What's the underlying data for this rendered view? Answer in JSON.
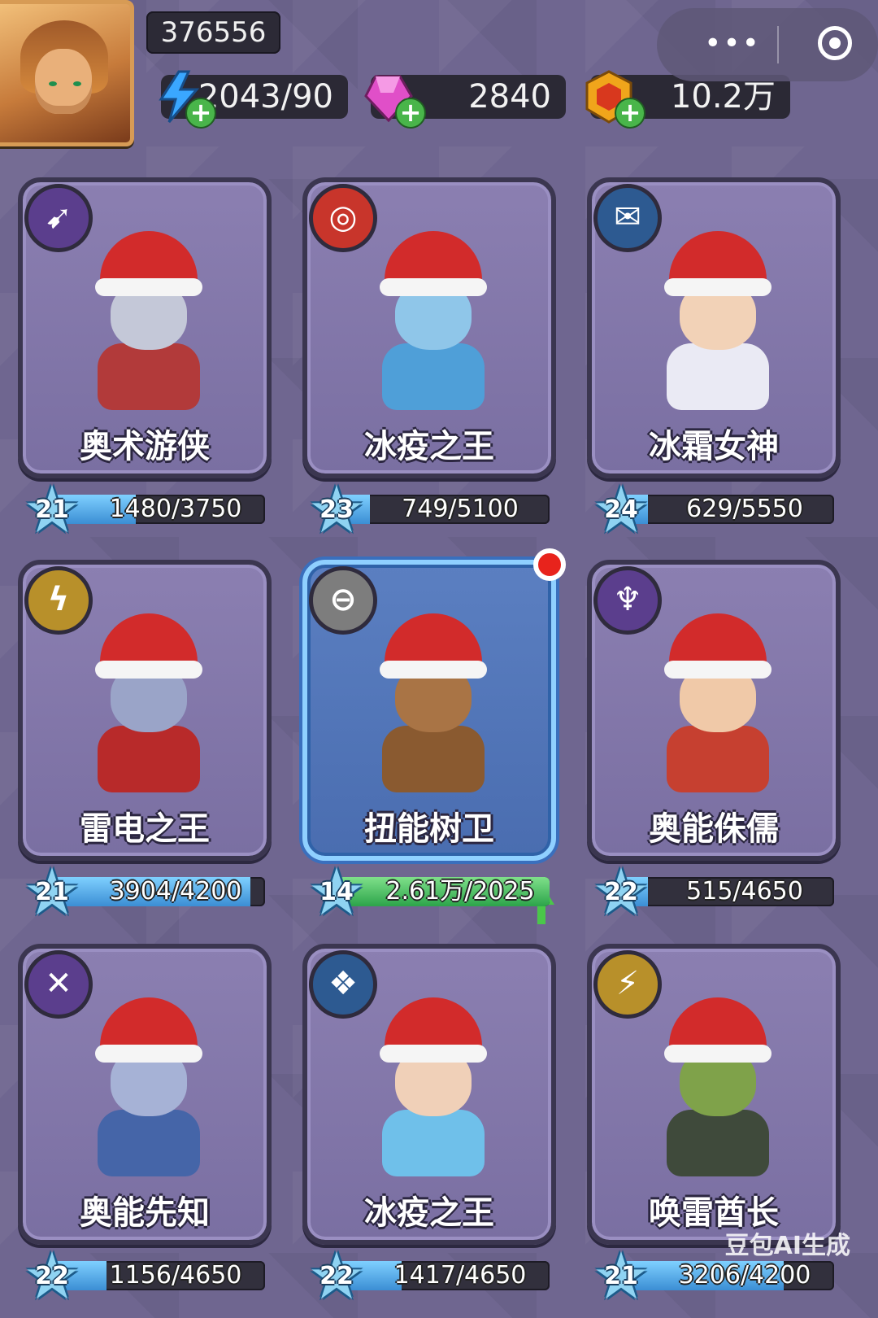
{
  "player": {
    "id": "376556"
  },
  "resources": {
    "energy": {
      "value": "2043/90",
      "icon": "lightning-icon"
    },
    "gems": {
      "value": "2840",
      "icon": "gem-icon"
    },
    "gold": {
      "value": "10.2万",
      "icon": "coin-icon"
    }
  },
  "capsule": {
    "more": "•••"
  },
  "heroes": [
    {
      "name": "奥术游侠",
      "level": "21",
      "progress": "1480/3750",
      "ratio": 0.39,
      "badge": "bow-icon",
      "badge_color": "#5b3e8d",
      "cloth": "#b23a3a",
      "skin": "#c4c8d8"
    },
    {
      "name": "冰疫之王",
      "level": "23",
      "progress": "749/5100",
      "ratio": 0.15,
      "badge": "fire-ring-icon",
      "badge_color": "#c8352b",
      "cloth": "#4f9fd8",
      "skin": "#8fc6e9"
    },
    {
      "name": "冰霜女神",
      "level": "24",
      "progress": "629/5550",
      "ratio": 0.11,
      "badge": "ice-shard-icon",
      "badge_color": "#2d5a91",
      "cloth": "#eaeaf4",
      "skin": "#f2d2b7"
    },
    {
      "name": "雷电之王",
      "level": "21",
      "progress": "3904/4200",
      "ratio": 0.93,
      "badge": "lightning-badge-icon",
      "badge_color": "#b8902a",
      "cloth": "#b82a2a",
      "skin": "#9aa4c8"
    },
    {
      "name": "扭能树卫",
      "level": "14",
      "progress": "2.61万/2025",
      "ratio": 1,
      "badge": "helmet-icon",
      "badge_color": "#7d7d7d",
      "cloth": "#8a5a30",
      "skin": "#a97445",
      "selected": true
    },
    {
      "name": "奥能侏儒",
      "level": "22",
      "progress": "515/4650",
      "ratio": 0.11,
      "badge": "claw-icon",
      "badge_color": "#5b3e8d",
      "cloth": "#c64030",
      "skin": "#f0c9a8"
    },
    {
      "name": "奥能先知",
      "level": "22",
      "progress": "1156/4650",
      "ratio": 0.25,
      "badge": "crossed-staff-icon",
      "badge_color": "#5b3e8d",
      "cloth": "#4565a8",
      "skin": "#a6b2d6"
    },
    {
      "name": "冰疫之王",
      "level": "22",
      "progress": "1417/4650",
      "ratio": 0.3,
      "badge": "crystal-icon",
      "badge_color": "#2d5a91",
      "cloth": "#6fc0ea",
      "skin": "#f0d0b8"
    },
    {
      "name": "唤雷酋长",
      "level": "21",
      "progress": "3206/4200",
      "ratio": 0.76,
      "badge": "thunder-badge-icon",
      "badge_color": "#b8902a",
      "cloth": "#3f4a3b",
      "skin": "#7fa24a"
    }
  ],
  "watermark": "豆包AI生成"
}
